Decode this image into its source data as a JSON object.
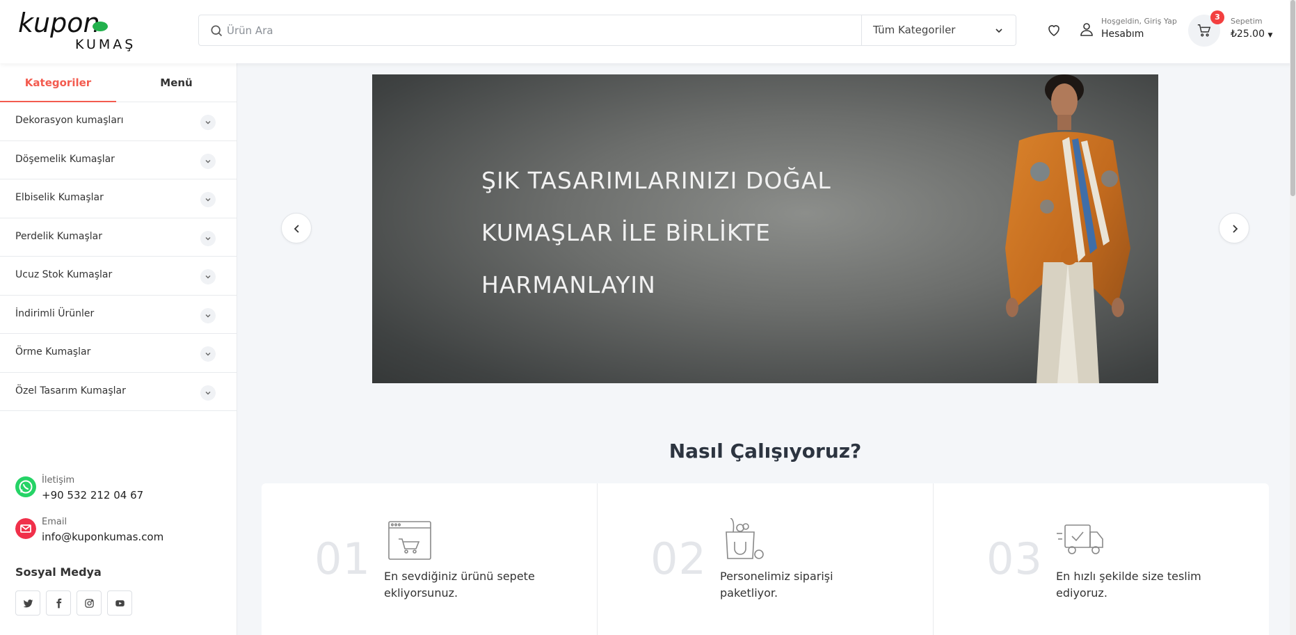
{
  "header": {
    "search_placeholder": "Ürün Ara",
    "category_select": "Tüm Kategoriler",
    "account_greeting": "Hoşgeldin, Giriş Yap",
    "account_label": "Hesabım",
    "cart_label": "Sepetim",
    "cart_total": "₺25.00",
    "cart_count": "3"
  },
  "sidebar": {
    "tabs": [
      "Kategoriler",
      "Menü"
    ],
    "active_tab": "Kategoriler",
    "categories": [
      "Dekorasyon kumaşları",
      "Döşemelik Kumaşlar",
      "Elbiselik Kumaşlar",
      "Perdelik Kumaşlar",
      "Ucuz Stok Kumaşlar",
      "İndirimli Ürünler",
      "Örme Kumaşlar",
      "Özel Tasarım Kumaşlar"
    ],
    "contact": {
      "phone_label": "İletişim",
      "phone": "+90 532 212 04 67",
      "email_label": "Email",
      "email": "info@kuponkumas.com"
    },
    "social_title": "Sosyal Medya",
    "social_icons": [
      "twitter-icon",
      "facebook-icon",
      "instagram-icon",
      "youtube-icon"
    ]
  },
  "hero": {
    "lines": [
      "ŞIK TASARIMLARINIZI DOĞAL",
      "KUMAŞLAR İLE BİRLİKTE",
      "HARMANLAYIN"
    ]
  },
  "how_it_works": {
    "title": "Nasıl Çalışıyoruz?",
    "steps": [
      {
        "num": "01",
        "text": "En sevdiğiniz ürünü sepete ekliyorsunuz.",
        "icon": "browser-cart-icon"
      },
      {
        "num": "02",
        "text": "Personelimiz siparişi paketliyor.",
        "icon": "shopping-bag-icon"
      },
      {
        "num": "03",
        "text": "En hızlı şekilde size teslim ediyoruz.",
        "icon": "delivery-truck-icon"
      }
    ]
  },
  "colors": {
    "accent": "#f35b4f",
    "badge": "#f33f3f",
    "whatsapp": "#25d366",
    "email": "#f0304a",
    "background": "#f4f6f9"
  }
}
